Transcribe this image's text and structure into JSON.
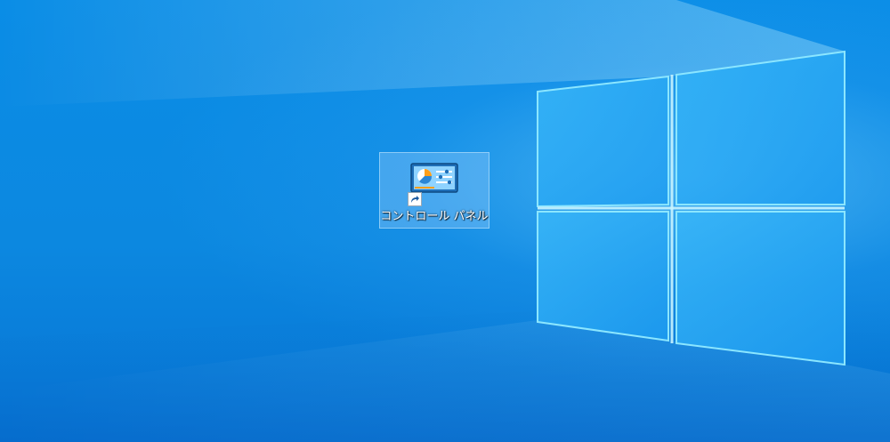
{
  "desktop": {
    "icons": [
      {
        "label": "コントロール パネル",
        "icon": "control-panel-icon",
        "overlay": "shortcut-arrow-icon"
      }
    ]
  },
  "colors": {
    "wallpaper_base": "#0a8de6",
    "window_logo_glow": "#6fd6ff",
    "selection_fill": "#4aa8f0"
  }
}
